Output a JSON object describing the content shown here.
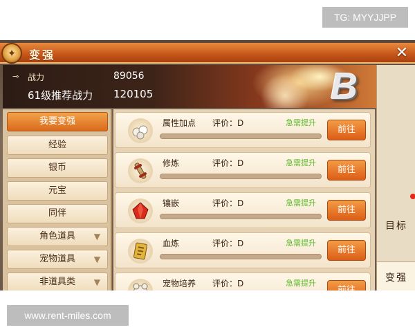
{
  "watermarks": {
    "top_right": "TG: MYYJJPP",
    "bottom_left": "www.rent-miles.com"
  },
  "window": {
    "title": "变强",
    "close_icon": "close-icon"
  },
  "header": {
    "power_label": "战力",
    "power_value": "89056",
    "recommended_label": "61级推荐战力",
    "recommended_value": "120105",
    "grade": "B"
  },
  "categories": [
    {
      "label": "我要变强",
      "active": true,
      "chevron": false
    },
    {
      "label": "经验",
      "active": false,
      "chevron": false
    },
    {
      "label": "银币",
      "active": false,
      "chevron": false
    },
    {
      "label": "元宝",
      "active": false,
      "chevron": false
    },
    {
      "label": "同伴",
      "active": false,
      "chevron": false
    },
    {
      "label": "角色道具",
      "active": false,
      "chevron": true
    },
    {
      "label": "宠物道具",
      "active": false,
      "chevron": true
    },
    {
      "label": "非道具类",
      "active": false,
      "chevron": true
    }
  ],
  "upgrades": [
    {
      "name": "属性加点",
      "rating": "评价：D",
      "status": "急需提升",
      "button": "前往",
      "icon": "pearls-icon",
      "progress": 0
    },
    {
      "name": "修炼",
      "rating": "评价：D",
      "status": "急需提升",
      "button": "前往",
      "icon": "scroll-icon",
      "progress": 0
    },
    {
      "name": "镶嵌",
      "rating": "评价：D",
      "status": "急需提升",
      "button": "前往",
      "icon": "red-gem-icon",
      "progress": 0
    },
    {
      "name": "血炼",
      "rating": "评价：D",
      "status": "急需提升",
      "button": "前往",
      "icon": "golden-rune-icon",
      "progress": 0
    },
    {
      "name": "宠物培养",
      "rating": "评价：D",
      "status": "急需提升",
      "button": "前往",
      "icon": "pet-icon",
      "progress": 0
    }
  ],
  "right_tabs": [
    {
      "label": "目标",
      "active": false
    },
    {
      "label": "变强",
      "active": true
    }
  ],
  "colors": {
    "accent_orange": "#dc5d17",
    "urgent_green": "#5bb82a",
    "notification_red": "#e8261a"
  }
}
